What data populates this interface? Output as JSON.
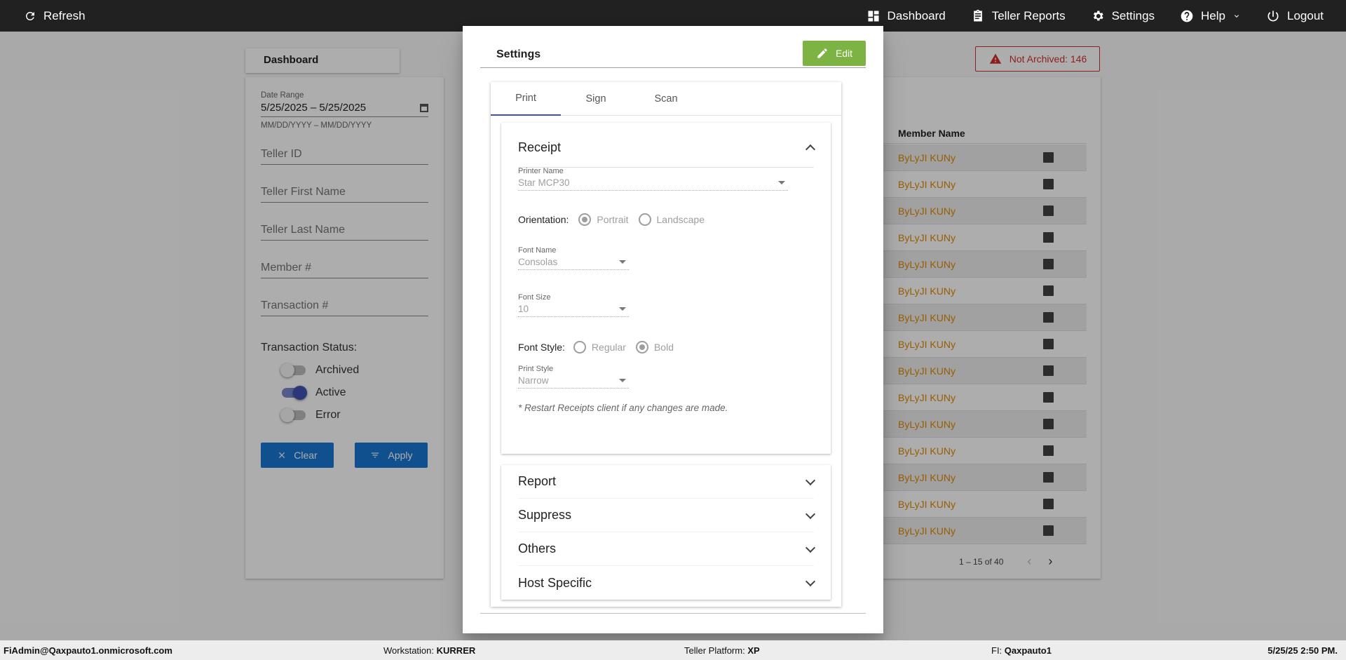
{
  "topbar": {
    "refresh_label": "Refresh",
    "nav": [
      {
        "label": "Dashboard",
        "icon": "dashboard-icon"
      },
      {
        "label": "Teller Reports",
        "icon": "clipboard-icon"
      },
      {
        "label": "Settings",
        "icon": "gear-icon"
      },
      {
        "label": "Help",
        "icon": "help-icon"
      },
      {
        "label": "Logout",
        "icon": "power-icon"
      }
    ]
  },
  "background": {
    "dashboard_title": "Dashboard",
    "filters": {
      "date_range_label": "Date Range",
      "date_range_value": "5/25/2025 – 5/25/2025",
      "date_hint": "MM/DD/YYYY – MM/DD/YYYY",
      "teller_id": "Teller ID",
      "teller_first": "Teller First Name",
      "teller_last": "Teller Last Name",
      "member": "Member #",
      "transaction": "Transaction #",
      "status_title": "Transaction Status:",
      "toggles": [
        {
          "label": "Archived",
          "on": false
        },
        {
          "label": "Active",
          "on": true
        },
        {
          "label": "Error",
          "on": false
        }
      ],
      "clear_label": "Clear",
      "apply_label": "Apply"
    },
    "not_archived": "Not Archived: 146",
    "table": {
      "column": "Member Name",
      "rows": [
        "ByLyJI KUNy",
        "ByLyJI KUNy",
        "ByLyJI KUNy",
        "ByLyJI KUNy",
        "ByLyJI KUNy",
        "ByLyJI KUNy",
        "ByLyJI KUNy",
        "ByLyJI KUNy",
        "ByLyJI KUNy",
        "ByLyJI KUNy",
        "ByLyJI KUNy",
        "ByLyJI KUNy",
        "ByLyJI KUNy",
        "ByLyJI KUNy",
        "ByLyJI KUNy"
      ],
      "pagination": "1 – 15 of 40"
    }
  },
  "modal": {
    "title": "Settings",
    "edit_label": "Edit",
    "tabs": [
      "Print",
      "Sign",
      "Scan"
    ],
    "active_tab": "Print",
    "receipt": {
      "title": "Receipt",
      "printer_name_label": "Printer Name",
      "printer_name_value": "Star MCP30",
      "orientation_label": "Orientation:",
      "orientation_options": [
        "Portrait",
        "Landscape"
      ],
      "orientation_selected": "Portrait",
      "font_name_label": "Font Name",
      "font_name_value": "Consolas",
      "font_size_label": "Font Size",
      "font_size_value": "10",
      "font_style_label": "Font Style:",
      "font_style_options": [
        "Regular",
        "Bold"
      ],
      "font_style_selected": "Bold",
      "print_style_label": "Print Style",
      "print_style_value": "Narrow",
      "note": "* Restart Receipts client if any changes are made."
    },
    "sections": [
      "Report",
      "Suppress",
      "Others",
      "Host Specific"
    ]
  },
  "statusbar": {
    "user": "FiAdmin@Qaxpauto1.onmicrosoft.com",
    "workstation_label": "Workstation:",
    "workstation": "KURRER",
    "platform_label": "Teller Platform:",
    "platform": "XP",
    "fi_label": "FI:",
    "fi": "Qaxpauto1",
    "datetime": "5/25/25 2:50 PM."
  },
  "colors": {
    "topbar": "#212121",
    "edit_button": "#7cb342",
    "primary": "#1976d2",
    "tab_indicator": "#3f51b5",
    "member_link": "#e08a00",
    "alert": "#d32f2f"
  }
}
